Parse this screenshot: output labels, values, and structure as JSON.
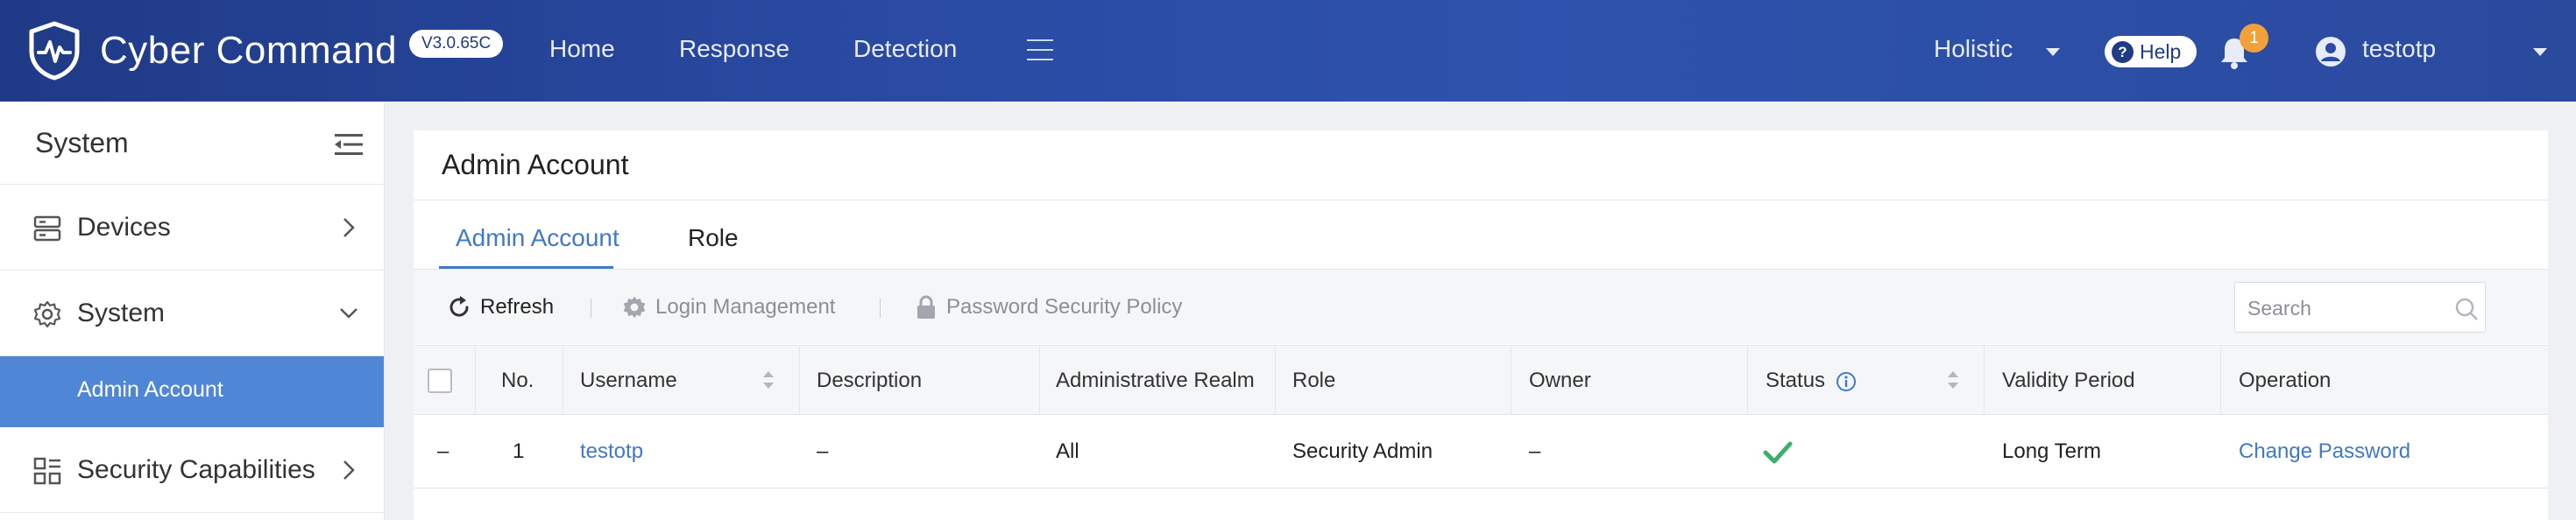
{
  "header": {
    "app_name": "Cyber Command",
    "version": "V3.0.65C",
    "nav": [
      "Home",
      "Response",
      "Detection"
    ],
    "scope": "Holistic",
    "help_label": "Help",
    "notification_count": "1",
    "user": "testotp"
  },
  "sidebar": {
    "title": "System",
    "items": [
      {
        "label": "Devices"
      },
      {
        "label": "System"
      },
      {
        "label": "Admin Account"
      },
      {
        "label": "Security Capabilities"
      }
    ]
  },
  "page": {
    "title": "Admin Account",
    "tabs": [
      "Admin Account",
      "Role"
    ],
    "toolbar": {
      "refresh": "Refresh",
      "login_mgmt": "Login Management",
      "pwd_policy": "Password Security Policy",
      "search_placeholder": "Search"
    },
    "table": {
      "columns": [
        "No.",
        "Username",
        "Description",
        "Administrative Realm",
        "Role",
        "Owner",
        "Status",
        "Validity Period",
        "Operation"
      ],
      "rows": [
        {
          "expand": "–",
          "no": "1",
          "username": "testotp",
          "description": "–",
          "realm": "All",
          "role": "Security Admin",
          "owner": "–",
          "status": "active",
          "validity": "Long Term",
          "operation": "Change Password"
        }
      ]
    }
  },
  "colors": {
    "header_bg": "#2a4aa3",
    "accent": "#3f79c9",
    "sidebar_active": "#4f86d6",
    "status_ok": "#3fae6a",
    "badge": "#f2a03a"
  }
}
